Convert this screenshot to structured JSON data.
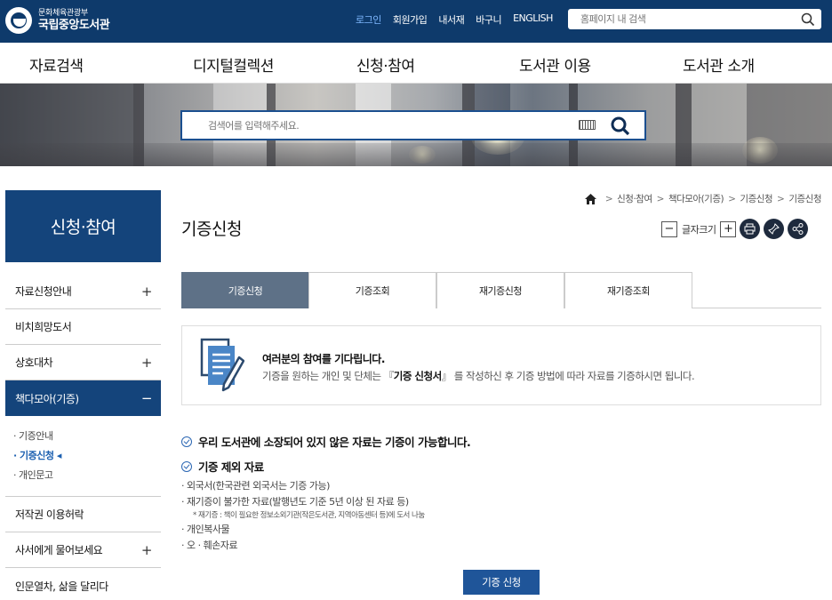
{
  "header": {
    "logo_sub": "문화체육관광부",
    "logo_main": "국립중앙도서관",
    "util_links": [
      "로그인",
      "회원가입",
      "내서재",
      "바구니",
      "ENGLISH"
    ],
    "site_search_placeholder": "홈페이지 내 검색"
  },
  "gnb": [
    "자료검색",
    "디지털컬렉션",
    "신청·참여",
    "도서관 이용",
    "도서관 소개"
  ],
  "hero_search": {
    "placeholder": "검색어를 입력해주세요."
  },
  "sidebar": {
    "title": "신청·참여",
    "items": [
      {
        "label": "자료신청안내",
        "toggle": "+"
      },
      {
        "label": "비치희망도서",
        "toggle": ""
      },
      {
        "label": "상호대차",
        "toggle": "+"
      },
      {
        "label": "책다모아(기증)",
        "toggle": "−"
      },
      {
        "label": "저작권 이용허락",
        "toggle": ""
      },
      {
        "label": "사서에게 물어보세요",
        "toggle": "+"
      },
      {
        "label": "인문열차, 삶을 달리다",
        "toggle": ""
      }
    ],
    "sub_items": [
      "· 기증안내",
      "· 기증신청 ◂",
      "· 개인문고"
    ]
  },
  "breadcrumb": [
    "신청·참여",
    "책다모아(기증)",
    "기증신청",
    "기증신청"
  ],
  "page_title": "기증신청",
  "font_size": {
    "minus": "−",
    "label": "글자크기",
    "plus": "+"
  },
  "tabs": [
    "기증신청",
    "기증조회",
    "재기증신청",
    "재기증조회"
  ],
  "notice": {
    "title": "여러분의 참여를 기다립니다.",
    "desc_before": "기증을 원하는 개인 및 단체는 『",
    "desc_bold": "기증 신청서",
    "desc_after": "』 를 작성하신 후 기증 방법에 따라 자료를 기증하시면 됩니다."
  },
  "section1": "우리 도서관에 소장되어 있지 않은 자료는 기증이 가능합니다.",
  "section2": "기증 제외 자료",
  "exclusions": [
    "· 외국서(한국관련 외국서는 기증 가능)",
    "· 재기증이 불가한 자료(발행년도 기준 5년 이상 된 자료 등)",
    "* 재기증 : 책이 필요한 정보소외기관(작은도서관, 지역아동센터 등)에 도서 나눔",
    "· 개인복사물",
    "· 오 · 훼손자료"
  ],
  "apply_button": "기증 신청",
  "colors": {
    "header": "#0e3a6b",
    "sidebar_active": "#14447b",
    "tab_active": "#5e7187",
    "button": "#1f5599"
  }
}
